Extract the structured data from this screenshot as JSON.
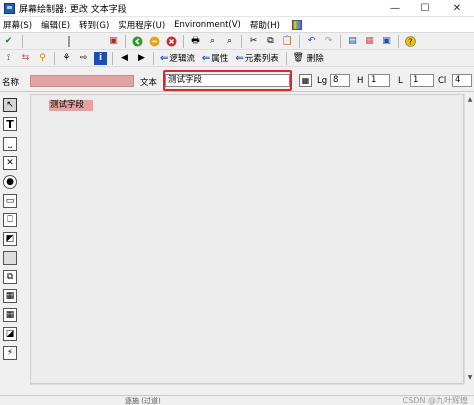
{
  "window": {
    "title": "屏幕绘制器:  更改 文本字段",
    "minimize": "—",
    "maximize": "☐",
    "close": "✕"
  },
  "menubar": {
    "items": [
      "屏幕(S)",
      "编辑(E)",
      "转到(G)",
      "实用程序(U)",
      "Environment(V)",
      "帮助(H)"
    ]
  },
  "toolbar2": {
    "logic_flow": "逻辑流",
    "attributes": "属性",
    "element_list": "元素列表",
    "delete": "删除"
  },
  "attributes": {
    "name_label": "名称",
    "name_value": "",
    "text_label": "文本",
    "text_value": "测试字段",
    "lg_label": "Lg",
    "lg_value": "8",
    "h_label": "H",
    "h_value": "1",
    "l_label": "L",
    "l_value": "1",
    "cl_label": "Cl",
    "cl_value": "4"
  },
  "canvas": {
    "field_text": "测试字段"
  },
  "statusbar": {
    "text": "逐施  (过道)",
    "watermark": "CSDN @九叶辉煌"
  },
  "colors": {
    "field_bg": "#e3a3a3",
    "highlight_frame": "#d82a2a",
    "title_icon": "#1f5fae"
  }
}
